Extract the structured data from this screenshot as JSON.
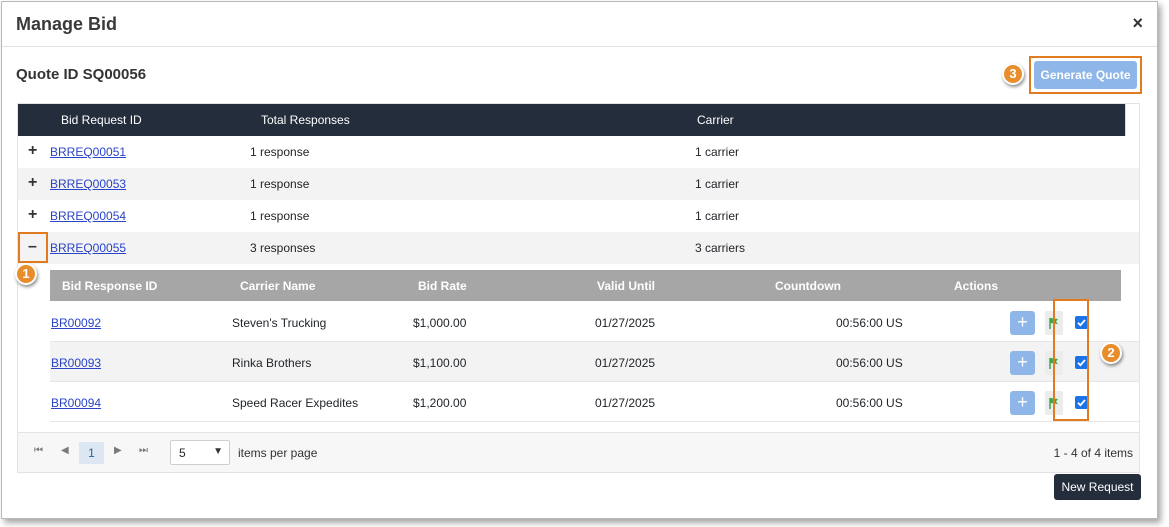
{
  "dialog": {
    "title": "Manage Bid",
    "close_icon": "close-icon",
    "close_glyph": "×"
  },
  "quote": {
    "label": "Quote ID SQ00056",
    "generate_label": "Generate Quote"
  },
  "callouts": [
    "1",
    "2",
    "3"
  ],
  "bid_grid": {
    "columns": [
      "Bid Request ID",
      "Total Responses",
      "Carrier"
    ],
    "rows": [
      {
        "toggle": "+",
        "id": "BRREQ00051",
        "responses": "1 response",
        "carrier": "1 carrier"
      },
      {
        "toggle": "+",
        "id": "BRREQ00053",
        "responses": "1 response",
        "carrier": "1 carrier"
      },
      {
        "toggle": "+",
        "id": "BRREQ00054",
        "responses": "1 response",
        "carrier": "1 carrier"
      },
      {
        "toggle": "–",
        "id": "BRREQ00055",
        "responses": "3 responses",
        "carrier": "3 carriers"
      }
    ]
  },
  "response_grid": {
    "columns": [
      "Bid Response ID",
      "Carrier Name",
      "Bid Rate",
      "Valid Until",
      "Countdown",
      "Actions"
    ],
    "rows": [
      {
        "id": "BR00092",
        "carrier": "Steven's Trucking",
        "rate": "$1,000.00",
        "valid": "01/27/2025",
        "countdown": "00:56:00 US",
        "checked": true
      },
      {
        "id": "BR00093",
        "carrier": "Rinka Brothers",
        "rate": "$1,100.00",
        "valid": "01/27/2025",
        "countdown": "00:56:00 US",
        "checked": true
      },
      {
        "id": "BR00094",
        "carrier": "Speed Racer Expedites",
        "rate": "$1,200.00",
        "valid": "01/27/2025",
        "countdown": "00:56:00 US",
        "checked": true
      }
    ],
    "add_glyph": "+",
    "flag_color": "#3aa845",
    "check_color": "#1a73e8"
  },
  "pager": {
    "first_icon": "first-page-icon",
    "prev_icon": "prev-page-icon",
    "next_icon": "next-page-icon",
    "last_icon": "last-page-icon",
    "current_page": "1",
    "page_size": "5",
    "items_per_page_label": "items per page",
    "info": "1 - 4 of 4 items"
  },
  "new_request_label": "New Request",
  "colors": {
    "header_dark": "#232d3b",
    "accent_blue": "#8fb6e8",
    "callout_orange": "#e88d2b",
    "link_blue": "#2a43c7"
  }
}
